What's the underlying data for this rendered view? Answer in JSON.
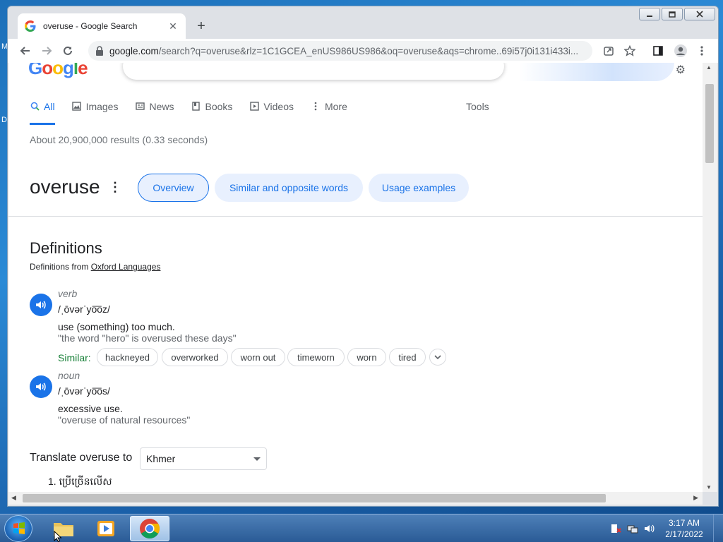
{
  "desktop": {
    "letter_m": "M",
    "letter_d": "D"
  },
  "browser": {
    "tab_title": "overuse - Google Search",
    "url_host": "google.com",
    "url_rest": "/search?q=overuse&rlz=1C1GCEA_enUS986US986&oq=overuse&aqs=chrome..69i57j0i131i433i..."
  },
  "page": {
    "logo": "Google",
    "nav": [
      {
        "label": "All",
        "icon": "search-icon",
        "active": true
      },
      {
        "label": "Images",
        "icon": "image-icon"
      },
      {
        "label": "News",
        "icon": "news-icon"
      },
      {
        "label": "Books",
        "icon": "book-icon"
      },
      {
        "label": "Videos",
        "icon": "play-icon"
      },
      {
        "label": "More",
        "icon": "more-vert-icon"
      }
    ],
    "tools": "Tools",
    "result_stats": "About 20,900,000 results (0.33 seconds)",
    "word": "overuse",
    "chips": [
      "Overview",
      "Similar and opposite words",
      "Usage examples"
    ],
    "definitions_heading": "Definitions",
    "definitions_from_prefix": "Definitions from ",
    "definitions_source": "Oxford Languages",
    "entries": [
      {
        "pos": "verb",
        "phonetic": "/ˌōvərˈyo͞oz/",
        "definition": "use (something) too much.",
        "example": "\"the word \"hero\" is overused these days\""
      },
      {
        "pos": "noun",
        "phonetic": "/ˌōvərˈyo͞os/",
        "definition": "excessive use.",
        "example": "\"overuse of natural resources\""
      }
    ],
    "similar_label": "Similar:",
    "synonyms": [
      "hackneyed",
      "overworked",
      "worn out",
      "timeworn",
      "worn",
      "tired"
    ],
    "translate_label": "Translate overuse to",
    "translate_language": "Khmer",
    "translation": "1. ប្រើច្រើនលើស"
  },
  "taskbar": {
    "time": "3:17 AM",
    "date": "2/17/2022"
  },
  "colors": {
    "accent": "#1a73e8",
    "similar_green": "#188038",
    "chip_bg": "#e8f0fe"
  }
}
